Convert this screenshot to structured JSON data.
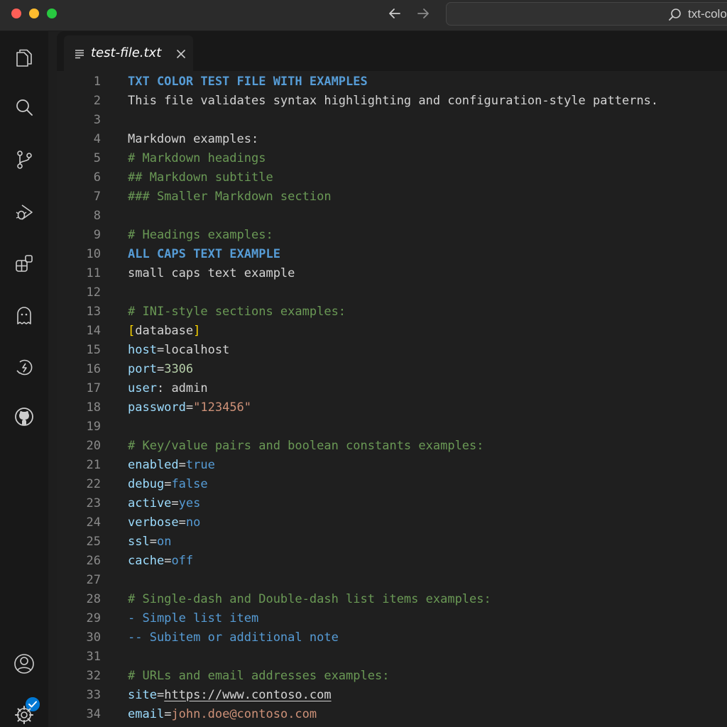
{
  "titlebar": {
    "search_text": "txt-colors"
  },
  "tab": {
    "label": "test-file.txt"
  },
  "activity_items": [
    {
      "name": "explorer-icon"
    },
    {
      "name": "search-icon"
    },
    {
      "name": "source-control-icon"
    },
    {
      "name": "run-debug-icon"
    },
    {
      "name": "extensions-icon"
    },
    {
      "name": "copilot-icon"
    },
    {
      "name": "remote-explorer-icon"
    },
    {
      "name": "github-icon"
    },
    {
      "name": "accounts-icon"
    },
    {
      "name": "settings-gear-icon"
    }
  ],
  "colors": {
    "heading": "#569cd6",
    "comment": "#6a9955",
    "string": "#ce9178",
    "number": "#b5cea8",
    "key": "#9cdcfe",
    "bracket": "#ffd700",
    "accent": "#0078d4"
  },
  "lines": [
    {
      "n": "1",
      "tokens": [
        {
          "t": "TXT COLOR TEST FILE WITH EXAMPLES",
          "c": "heading"
        }
      ]
    },
    {
      "n": "2",
      "tokens": [
        {
          "t": "This file validates syntax highlighting and configuration-style patterns.",
          "c": "text"
        }
      ]
    },
    {
      "n": "3",
      "tokens": []
    },
    {
      "n": "4",
      "tokens": [
        {
          "t": "Markdown examples:",
          "c": "text"
        }
      ]
    },
    {
      "n": "5",
      "tokens": [
        {
          "t": "# Markdown headings",
          "c": "comment"
        }
      ]
    },
    {
      "n": "6",
      "tokens": [
        {
          "t": "## Markdown subtitle",
          "c": "comment"
        }
      ]
    },
    {
      "n": "7",
      "tokens": [
        {
          "t": "### Smaller Markdown section",
          "c": "comment"
        }
      ]
    },
    {
      "n": "8",
      "tokens": []
    },
    {
      "n": "9",
      "tokens": [
        {
          "t": "# Headings examples:",
          "c": "comment"
        }
      ]
    },
    {
      "n": "10",
      "tokens": [
        {
          "t": "ALL CAPS TEXT EXAMPLE",
          "c": "heading"
        }
      ]
    },
    {
      "n": "11",
      "tokens": [
        {
          "t": "small caps text example",
          "c": "text"
        }
      ]
    },
    {
      "n": "12",
      "tokens": []
    },
    {
      "n": "13",
      "tokens": [
        {
          "t": "# INI-style sections examples:",
          "c": "comment"
        }
      ]
    },
    {
      "n": "14",
      "tokens": [
        {
          "t": "[",
          "c": "bracket"
        },
        {
          "t": "database",
          "c": "text"
        },
        {
          "t": "]",
          "c": "bracket"
        }
      ]
    },
    {
      "n": "15",
      "tokens": [
        {
          "t": "host",
          "c": "key"
        },
        {
          "t": "=",
          "c": "op"
        },
        {
          "t": "localhost",
          "c": "text"
        }
      ]
    },
    {
      "n": "16",
      "tokens": [
        {
          "t": "port",
          "c": "key"
        },
        {
          "t": "=",
          "c": "op"
        },
        {
          "t": "3306",
          "c": "num"
        }
      ]
    },
    {
      "n": "17",
      "tokens": [
        {
          "t": "user",
          "c": "key"
        },
        {
          "t": ": ",
          "c": "op"
        },
        {
          "t": "admin",
          "c": "text"
        }
      ]
    },
    {
      "n": "18",
      "tokens": [
        {
          "t": "password",
          "c": "key"
        },
        {
          "t": "=",
          "c": "op"
        },
        {
          "t": "\"123456\"",
          "c": "str"
        }
      ]
    },
    {
      "n": "19",
      "tokens": []
    },
    {
      "n": "20",
      "tokens": [
        {
          "t": "# Key/value pairs and boolean constants examples:",
          "c": "comment"
        }
      ]
    },
    {
      "n": "21",
      "tokens": [
        {
          "t": "enabled",
          "c": "key"
        },
        {
          "t": "=",
          "c": "op"
        },
        {
          "t": "true",
          "c": "bool"
        }
      ]
    },
    {
      "n": "22",
      "tokens": [
        {
          "t": "debug",
          "c": "key"
        },
        {
          "t": "=",
          "c": "op"
        },
        {
          "t": "false",
          "c": "bool"
        }
      ]
    },
    {
      "n": "23",
      "tokens": [
        {
          "t": "active",
          "c": "key"
        },
        {
          "t": "=",
          "c": "op"
        },
        {
          "t": "yes",
          "c": "bool"
        }
      ]
    },
    {
      "n": "24",
      "tokens": [
        {
          "t": "verbose",
          "c": "key"
        },
        {
          "t": "=",
          "c": "op"
        },
        {
          "t": "no",
          "c": "bool"
        }
      ]
    },
    {
      "n": "25",
      "tokens": [
        {
          "t": "ssl",
          "c": "key"
        },
        {
          "t": "=",
          "c": "op"
        },
        {
          "t": "on",
          "c": "bool"
        }
      ]
    },
    {
      "n": "26",
      "tokens": [
        {
          "t": "cache",
          "c": "key"
        },
        {
          "t": "=",
          "c": "op"
        },
        {
          "t": "off",
          "c": "bool"
        }
      ]
    },
    {
      "n": "27",
      "tokens": []
    },
    {
      "n": "28",
      "tokens": [
        {
          "t": "# Single-dash and Double-dash list items examples:",
          "c": "comment"
        }
      ]
    },
    {
      "n": "29",
      "tokens": [
        {
          "t": "- Simple list item",
          "c": "listitem"
        }
      ]
    },
    {
      "n": "30",
      "tokens": [
        {
          "t": "-- Subitem or additional note",
          "c": "listitem"
        }
      ]
    },
    {
      "n": "31",
      "tokens": []
    },
    {
      "n": "32",
      "tokens": [
        {
          "t": "# URLs and email addresses examples:",
          "c": "comment"
        }
      ]
    },
    {
      "n": "33",
      "tokens": [
        {
          "t": "site",
          "c": "key"
        },
        {
          "t": "=",
          "c": "op"
        },
        {
          "t": "https://www.contoso.com",
          "c": "url"
        }
      ]
    },
    {
      "n": "34",
      "tokens": [
        {
          "t": "email",
          "c": "key"
        },
        {
          "t": "=",
          "c": "op"
        },
        {
          "t": "john.doe@contoso.com",
          "c": "email"
        }
      ]
    }
  ]
}
